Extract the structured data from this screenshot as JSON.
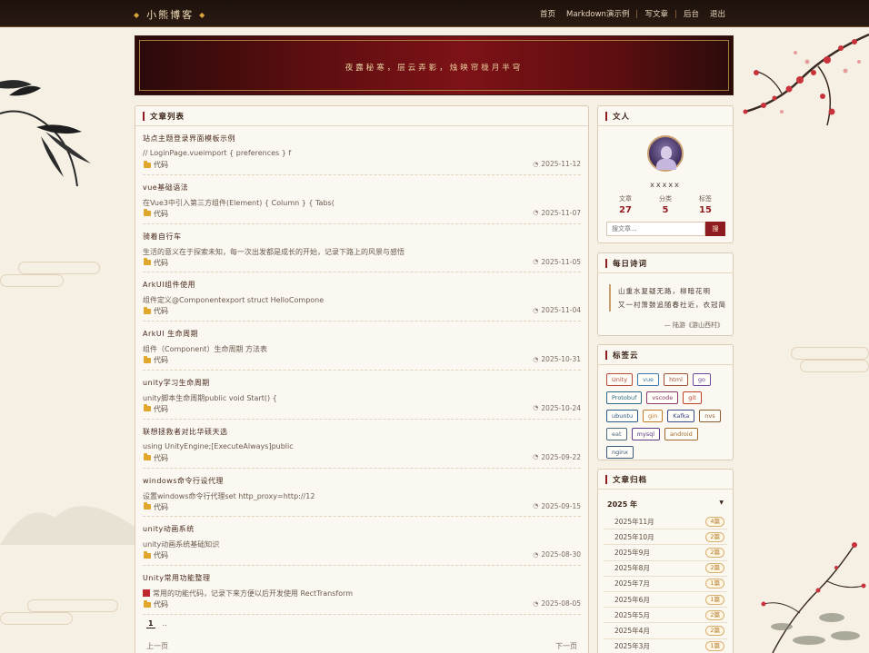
{
  "nav": {
    "brand": "小熊博客",
    "links": [
      "首页",
      "Markdown演示例",
      "写文章",
      "后台",
      "退出"
    ]
  },
  "hero": {
    "text": "夜露秘寒，层云弄影，烛映帘栊月半穹"
  },
  "articles": {
    "heading": "文章列表",
    "items": [
      {
        "title": "站点主题登录界面模板示例",
        "excerpt": "// LoginPage.vueimport { preferences } f",
        "category": "代码",
        "date": "2025-11-12",
        "red": false
      },
      {
        "title": "vue基础语法",
        "excerpt": "在Vue3中引入第三方组件(Element) { Column } { Tabs(",
        "category": "代码",
        "date": "2025-11-07",
        "red": false
      },
      {
        "title": "骑着自行车",
        "excerpt": "生活的意义在于探索未知，每一次出发都是成长的开始，记录下路上的风景与感悟",
        "category": "代码",
        "date": "2025-11-05",
        "red": false
      },
      {
        "title": "ArkUI组件使用",
        "excerpt": "组件定义@Componentexport struct HelloCompone",
        "category": "代码",
        "date": "2025-11-04",
        "red": false
      },
      {
        "title": "ArkUI 生命周期",
        "excerpt": "组件（Component）生命周期 方法表",
        "category": "代码",
        "date": "2025-10-31",
        "red": false
      },
      {
        "title": "unity学习生命周期",
        "excerpt": "unity脚本生命周期public void Start() {",
        "category": "代码",
        "date": "2025-10-24",
        "red": false
      },
      {
        "title": "联想拯救者对比华硕天选",
        "excerpt": "using UnityEngine;[ExecuteAlways]public",
        "category": "代码",
        "date": "2025-09-22",
        "red": false
      },
      {
        "title": "windows命令行设代理",
        "excerpt": "设置windows命令行代理set http_proxy=http://12",
        "category": "代码",
        "date": "2025-09-15",
        "red": false
      },
      {
        "title": "unity动画系统",
        "excerpt": "unity动画系统基础知识",
        "category": "代码",
        "date": "2025-08-30",
        "red": false
      },
      {
        "title": "Unity常用功能整理",
        "excerpt": "常用的功能代码，记录下来方便以后开发使用 RectTransform",
        "category": "代码",
        "date": "2025-08-05",
        "red": true
      }
    ],
    "pager": {
      "current": "1",
      "dots": "..",
      "prev": "上一页",
      "next": "下一页"
    }
  },
  "profile": {
    "name": "xxxxx",
    "stats": [
      {
        "label": "文章",
        "value": "27"
      },
      {
        "label": "分类",
        "value": "5"
      },
      {
        "label": "标签",
        "value": "15"
      }
    ],
    "search_placeholder": "搜文章...",
    "search_button": "搜"
  },
  "poem": {
    "heading": "每日诗词",
    "lines": [
      "山重水复疑无路，柳暗花明",
      "又一村箫鼓追随春社近，衣冠简"
    ],
    "source": "— 陆游《游山西村》"
  },
  "tags": {
    "heading": "标签云",
    "items": [
      {
        "label": "Unity",
        "color": "#b84a3a"
      },
      {
        "label": "vue",
        "color": "#3a7ab0"
      },
      {
        "label": "html",
        "color": "#a0523a"
      },
      {
        "label": "go",
        "color": "#6a4aa0"
      },
      {
        "label": "Protobuf",
        "color": "#2a6a8a"
      },
      {
        "label": "vscode",
        "color": "#8a3a6a"
      },
      {
        "label": "git",
        "color": "#c0402a"
      },
      {
        "label": "ubuntu",
        "color": "#2a5a8a"
      },
      {
        "label": "gin",
        "color": "#c07a2a"
      },
      {
        "label": "Kafka",
        "color": "#3a4a8a"
      },
      {
        "label": "nvs",
        "color": "#8a5a2a"
      },
      {
        "label": "eat",
        "color": "#4a6a7a"
      },
      {
        "label": "mysql",
        "color": "#5a3a8a"
      },
      {
        "label": "android",
        "color": "#a06a2a"
      },
      {
        "label": "nginx",
        "color": "#3a5a7a"
      }
    ]
  },
  "archive": {
    "heading": "文章归档",
    "year": "2025 年",
    "months": [
      {
        "label": "2025年11月",
        "count": "4篇"
      },
      {
        "label": "2025年10月",
        "count": "2篇"
      },
      {
        "label": "2025年9月",
        "count": "2篇"
      },
      {
        "label": "2025年8月",
        "count": "2篇"
      },
      {
        "label": "2025年7月",
        "count": "1篇"
      },
      {
        "label": "2025年6月",
        "count": "1篇"
      },
      {
        "label": "2025年5月",
        "count": "2篇"
      },
      {
        "label": "2025年4月",
        "count": "2篇"
      },
      {
        "label": "2025年3月",
        "count": "1篇"
      }
    ]
  }
}
